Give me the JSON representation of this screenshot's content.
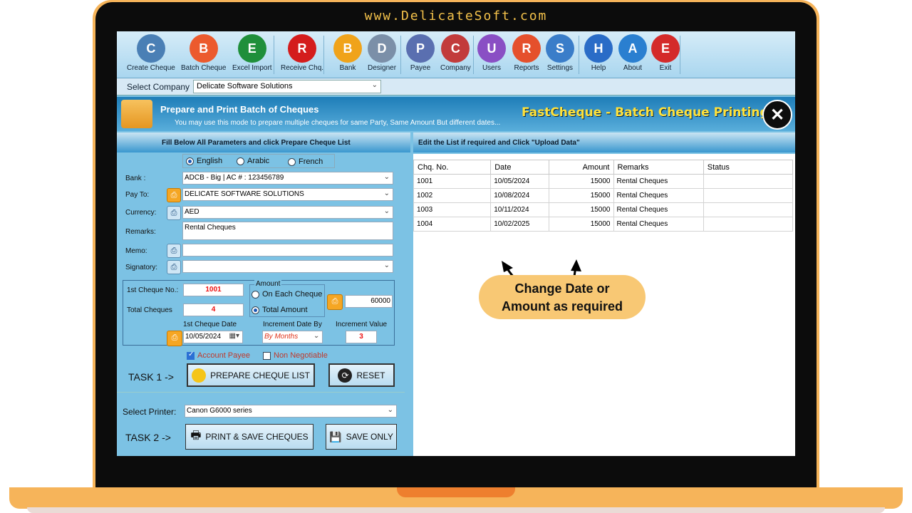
{
  "site_url": "www.DelicateSoft.com",
  "toolbar": [
    {
      "label": "Create Cheque",
      "icon": "printer-icon",
      "color": "#4a7fb5"
    },
    {
      "label": "Batch Cheque",
      "icon": "batch-cheque-icon",
      "color": "#ec5a2d"
    },
    {
      "label": "Excel Import",
      "icon": "excel-icon",
      "color": "#1f8f3a"
    },
    {
      "label": "Receive Chq.",
      "icon": "receive-cheque-icon",
      "color": "#d41c1c"
    },
    {
      "label": "Bank",
      "icon": "bank-icon",
      "color": "#f0a31a"
    },
    {
      "label": "Designer",
      "icon": "designer-icon",
      "color": "#7b8fa8"
    },
    {
      "label": "Payee",
      "icon": "payee-icon",
      "color": "#5a6fb0"
    },
    {
      "label": "Company",
      "icon": "company-icon",
      "color": "#c23b3b"
    },
    {
      "label": "Users",
      "icon": "users-icon",
      "color": "#8a4fc4"
    },
    {
      "label": "Reports",
      "icon": "reports-icon",
      "color": "#e5502c"
    },
    {
      "label": "Settings",
      "icon": "settings-icon",
      "color": "#3a7dc9"
    },
    {
      "label": "Help",
      "icon": "help-icon",
      "color": "#2a6cc7"
    },
    {
      "label": "About",
      "icon": "about-icon",
      "color": "#2a7fd0"
    },
    {
      "label": "Exit",
      "icon": "exit-icon",
      "color": "#d42a2a"
    }
  ],
  "company_bar": {
    "label": "Select Company",
    "value": "Delicate Software Solutions"
  },
  "header": {
    "title": "Prepare and Print Batch of Cheques",
    "subtitle": "You may use this mode to prepare multiple cheques for same Party, Same Amount But different dates...",
    "brand": "FastCheque - Batch Cheque Printing"
  },
  "left_section_title": "Fill Below All Parameters and click Prepare Cheque List",
  "right_section_title": "Edit the List if required and Click \"Upload Data\"",
  "languages": [
    {
      "label": "English",
      "selected": true
    },
    {
      "label": "Arabic",
      "selected": false
    },
    {
      "label": "French",
      "selected": false
    }
  ],
  "form": {
    "bank_label": "Bank :",
    "bank_value": "ADCB - Big | AC # :  123456789",
    "payto_label": "Pay To:",
    "payto_value": "DELICATE SOFTWARE SOLUTIONS",
    "currency_label": "Currency:",
    "currency_value": "AED",
    "remarks_label": "Remarks:",
    "remarks_value": "Rental Cheques",
    "memo_label": "Memo:",
    "memo_value": "",
    "signatory_label": "Signatory:",
    "signatory_value": "",
    "first_cheque_label": "1st Cheque No.:",
    "first_cheque_value": "1001",
    "total_cheques_label": "Total Cheques",
    "total_cheques_value": "4",
    "amount_group_label": "Amount",
    "on_each_label": "On Each Cheque",
    "total_amount_label": "Total Amount",
    "amount_value": "60000",
    "first_date_label": "1st Cheque Date",
    "first_date_value": "10/05/2024",
    "increment_by_label": "Increment Date By",
    "increment_by_value": "By Months",
    "increment_value_label": "Increment Value",
    "increment_value": "3",
    "account_payee": "Account Payee",
    "non_negotiable": "Non Negotiable",
    "task1": "TASK 1 ->",
    "prepare_btn": "PREPARE CHEQUE LIST",
    "reset_btn": "RESET",
    "printer_label": "Select Printer:",
    "printer_value": "Canon G6000 series",
    "task2": "TASK 2 ->",
    "print_save_btn": "PRINT & SAVE CHEQUES",
    "save_only_btn": "SAVE ONLY"
  },
  "table": {
    "columns": [
      "Chq. No.",
      "Date",
      "Amount",
      "Remarks",
      "Status"
    ],
    "rows": [
      [
        "1001",
        "10/05/2024",
        "15000",
        "Rental Cheques",
        ""
      ],
      [
        "1002",
        "10/08/2024",
        "15000",
        "Rental Cheques",
        ""
      ],
      [
        "1003",
        "10/11/2024",
        "15000",
        "Rental Cheques",
        ""
      ],
      [
        "1004",
        "10/02/2025",
        "15000",
        "Rental Cheques",
        ""
      ]
    ]
  },
  "callout": {
    "line1": "Change Date or",
    "line2": "Amount as required"
  }
}
